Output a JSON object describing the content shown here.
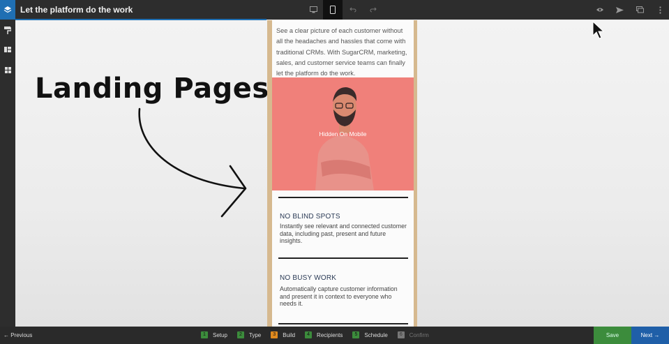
{
  "header": {
    "title": "Let the platform do the work",
    "icons": [
      "layers-icon",
      "desktop-icon",
      "mobile-icon",
      "undo-icon",
      "redo-icon",
      "eye-icon",
      "send-icon",
      "duplicate-icon",
      "more-icon"
    ]
  },
  "sidebar": {
    "icons": [
      "paint-roller-icon",
      "blocks-icon",
      "grid-icon"
    ]
  },
  "annotation": {
    "text": "Landing Pages"
  },
  "preview": {
    "intro": "See a clear picture of each customer without all the headaches and hassles that come with traditional CRMs. With SugarCRM, marketing, sales, and customer service teams can finally let the platform do the work.",
    "hero_label": "Hidden On Mobile",
    "features": [
      {
        "title": "NO BLIND SPOTS",
        "text": "Instantly see relevant and connected customer data, including past, present and future insights."
      },
      {
        "title": "NO BUSY WORK",
        "text": "Automatically capture customer information and present it in context to everyone who needs it."
      }
    ]
  },
  "footer": {
    "previous": "← Previous",
    "steps": [
      {
        "num": "1",
        "label": "Setup"
      },
      {
        "num": "2",
        "label": "Type"
      },
      {
        "num": "3",
        "label": "Build"
      },
      {
        "num": "4",
        "label": "Recipients"
      },
      {
        "num": "5",
        "label": "Schedule"
      },
      {
        "num": "6",
        "label": "Confirm"
      }
    ],
    "save": "Save",
    "next": "Next →"
  },
  "colors": {
    "accent": "#1f6fb3",
    "hero": "#f0807a",
    "done": "#3c8c3c",
    "current": "#e08a1e"
  }
}
